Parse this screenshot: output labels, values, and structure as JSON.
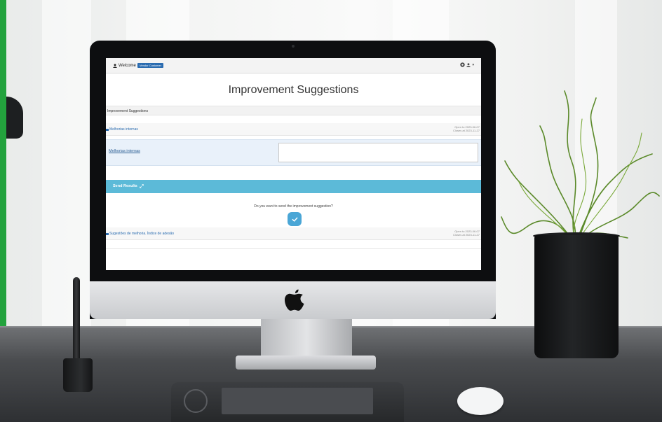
{
  "app": {
    "welcome_text": "Welcome",
    "user_badge": "Vendor Customer",
    "page_title": "Improvement Suggestions",
    "breadcrumb": "Improvement Suggestions",
    "sections": [
      {
        "label": "Melhorias internas",
        "date_open": "Open to 2023-06-07",
        "date_close": "Closes at 2023-11-27"
      },
      {
        "label": "Sugestões de melhoria. Índice de adesão",
        "date_open": "Open to 2023-06-07",
        "date_close": "Closes at 2023-11-27"
      }
    ],
    "form": {
      "field_label": "Melhorias internas",
      "field_value": ""
    },
    "send_results_label": "Send Results",
    "question": "Do you want to send the improvement suggestion?",
    "accent_color": "#5cbad8",
    "link_color": "#2b6cb0"
  },
  "icons": {
    "user": "user-icon",
    "gear": "gear-icon",
    "expand": "expand-icon",
    "check": "check-icon"
  }
}
